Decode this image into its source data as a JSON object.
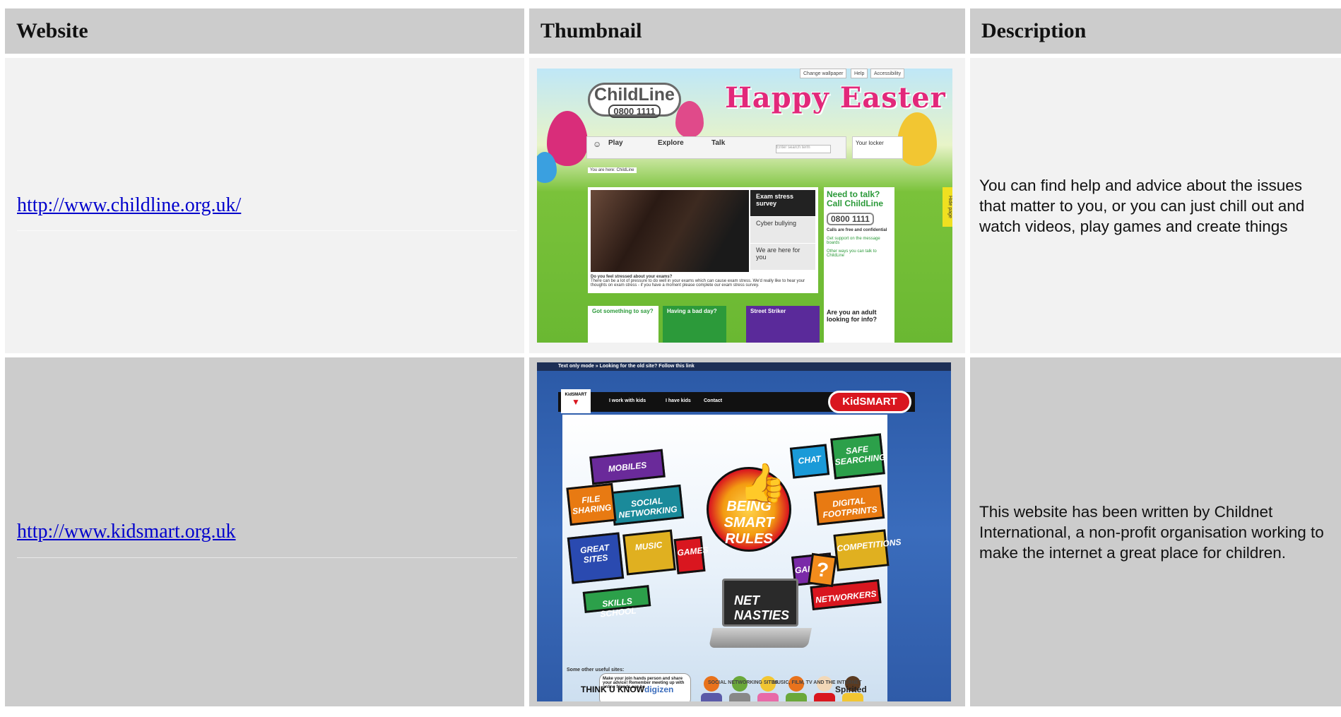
{
  "table": {
    "headers": [
      "Website",
      "Thumbnail",
      "Description"
    ],
    "rows": [
      {
        "url": "http://www.childline.org.uk/",
        "description": "You can find help and advice about the issues that matter to you, or you can just chill out and watch videos, play games and create things"
      },
      {
        "url": "http://www.kidsmart.org.uk",
        "description": "This website has been written by Childnet International, a non-profit organisation working to make the internet a great place for children."
      }
    ]
  },
  "thumb_childline": {
    "top_buttons": [
      "Change wallpaper",
      "Help",
      "Accessibility"
    ],
    "logo_name": "ChildLine",
    "logo_number": "0800 1111",
    "banner": "Happy Easter",
    "nav": [
      "Play",
      "Explore",
      "Talk"
    ],
    "search_placeholder": "Enter search term",
    "locker": "Your locker",
    "breadcrumb": "You are here: ChildLine",
    "menu": [
      "Exam stress survey",
      "Cyber bullying",
      "We are here for you"
    ],
    "caption_title": "Do you feel stressed about your exams?",
    "caption_text": "There can be a lot of pressure to do well in your exams which can cause exam stress. We'd really like to hear your thoughts on exam stress - if you have a moment please complete our exam stress survey.",
    "side_heading": "Need to talk? Call ChildLine",
    "side_number": "0800 1111",
    "side_note": "Calls are free and confidential",
    "side_links": [
      "Get support on the message boards",
      "Other ways you can talk to ChildLine"
    ],
    "hide_tab": "Hide page",
    "tiles": [
      "Got something to say?",
      "Having a bad day?",
      "Street Striker"
    ],
    "adult_box": "Are you an adult looking for info?"
  },
  "thumb_kidsmart": {
    "top_bar": "Text only mode »   Looking for the old site? Follow this link",
    "tab": "KidSMART",
    "nav": [
      "I work with kids",
      "I have kids",
      "Contact"
    ],
    "logo": "KidSMART",
    "tiles": [
      "MOBILES",
      "SOCIAL NETWORKING",
      "FILE SHARING",
      "CHAT",
      "SAFE SEARCHING",
      "DIGITAL FOOTPRINTS",
      "GREAT SITES",
      "MUSIC",
      "GAMES",
      "GALLERY",
      "COMPETITIONS",
      "SKILLS SCHOOL",
      "NETWORKERS"
    ],
    "burst": "BEING SMART RULES",
    "laptop": "NET NASTIES",
    "bubble": "Make your join hands person and share your advice! Remember meeting up with online friends can be",
    "useful": "Some other useful sites:",
    "partners": [
      "THINK U KNOW",
      "digizen",
      "SOCIAL NETWORKING SITES",
      "MUSIC, FILM, TV AND THE INTERNET",
      "Spirited"
    ]
  }
}
